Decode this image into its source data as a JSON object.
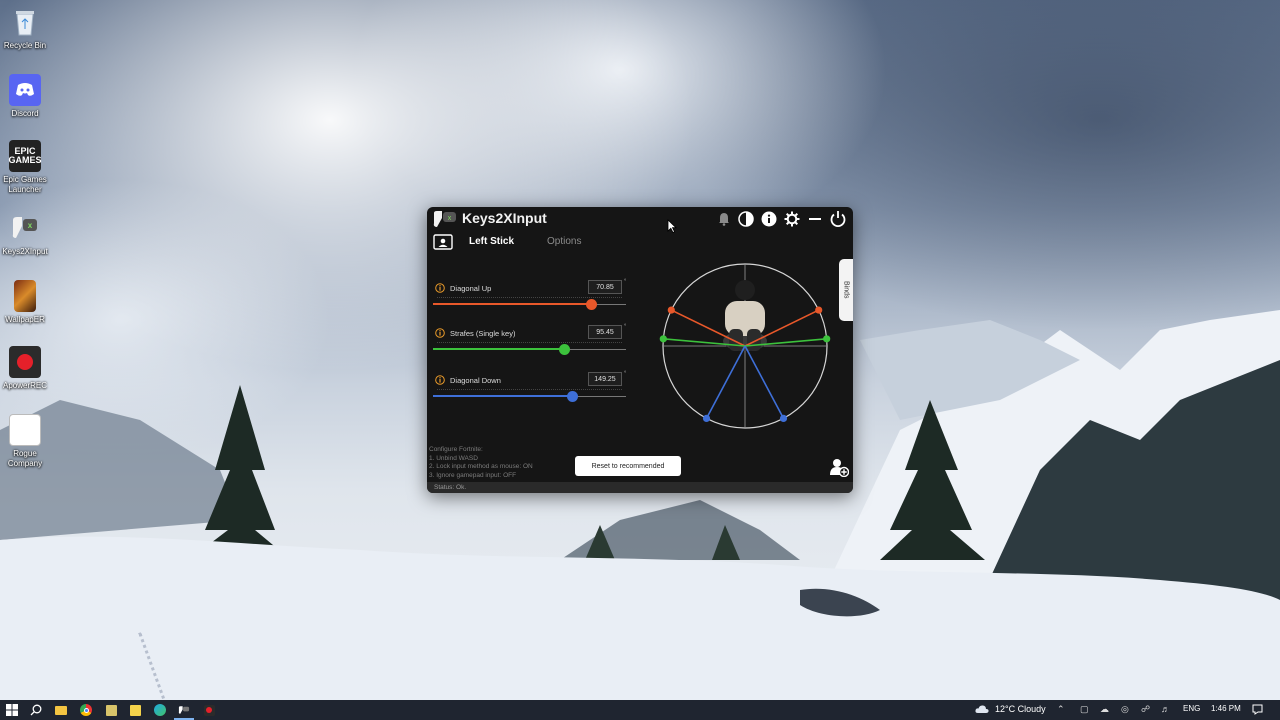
{
  "desktop": {
    "icons": [
      {
        "label": "Recycle Bin",
        "icon": "recycle-bin-icon"
      },
      {
        "label": "Discord",
        "icon": "discord-icon"
      },
      {
        "label": "Epic Games Launcher",
        "icon": "epic-games-icon",
        "badge": "EPIC GAMES"
      },
      {
        "label": "Keys2XInput",
        "icon": "keys2xinput-icon"
      },
      {
        "label": "WallpapER",
        "icon": "wallpaper-engine-icon"
      },
      {
        "label": "ApowerREC",
        "icon": "apowerrec-icon"
      },
      {
        "label": "Rogue Company",
        "icon": "document-icon"
      }
    ]
  },
  "app": {
    "title": "Keys2XInput",
    "titlebar_buttons": [
      "bell-icon",
      "contrast-icon",
      "info-icon",
      "gear-icon",
      "minimize-icon",
      "power-icon"
    ],
    "tabs": {
      "active": "Left Stick",
      "inactive": "Options"
    },
    "settings": [
      {
        "label": "Diagonal Up",
        "value": "70.85",
        "unit": "°",
        "fraction": 0.82,
        "color": "#e8582a"
      },
      {
        "label": "Strafes (Single key)",
        "value": "95.45",
        "unit": "°",
        "fraction": 0.68,
        "color": "#3cc23c"
      },
      {
        "label": "Diagonal Down",
        "value": "149.25",
        "unit": "°",
        "fraction": 0.72,
        "color": "#3e6fd8"
      }
    ],
    "binds_label": "Binds",
    "config_note": [
      "Configure Fortnite:",
      "1. Unbind WASD",
      "2. Lock input method as mouse: ON",
      "3. Ignore gamepad input: OFF"
    ],
    "reset_label": "Reset to recommended",
    "status": "Status: Ok."
  },
  "taskbar": {
    "weather": "12°C  Cloudy",
    "language": "ENG",
    "time": "1:46 PM"
  }
}
